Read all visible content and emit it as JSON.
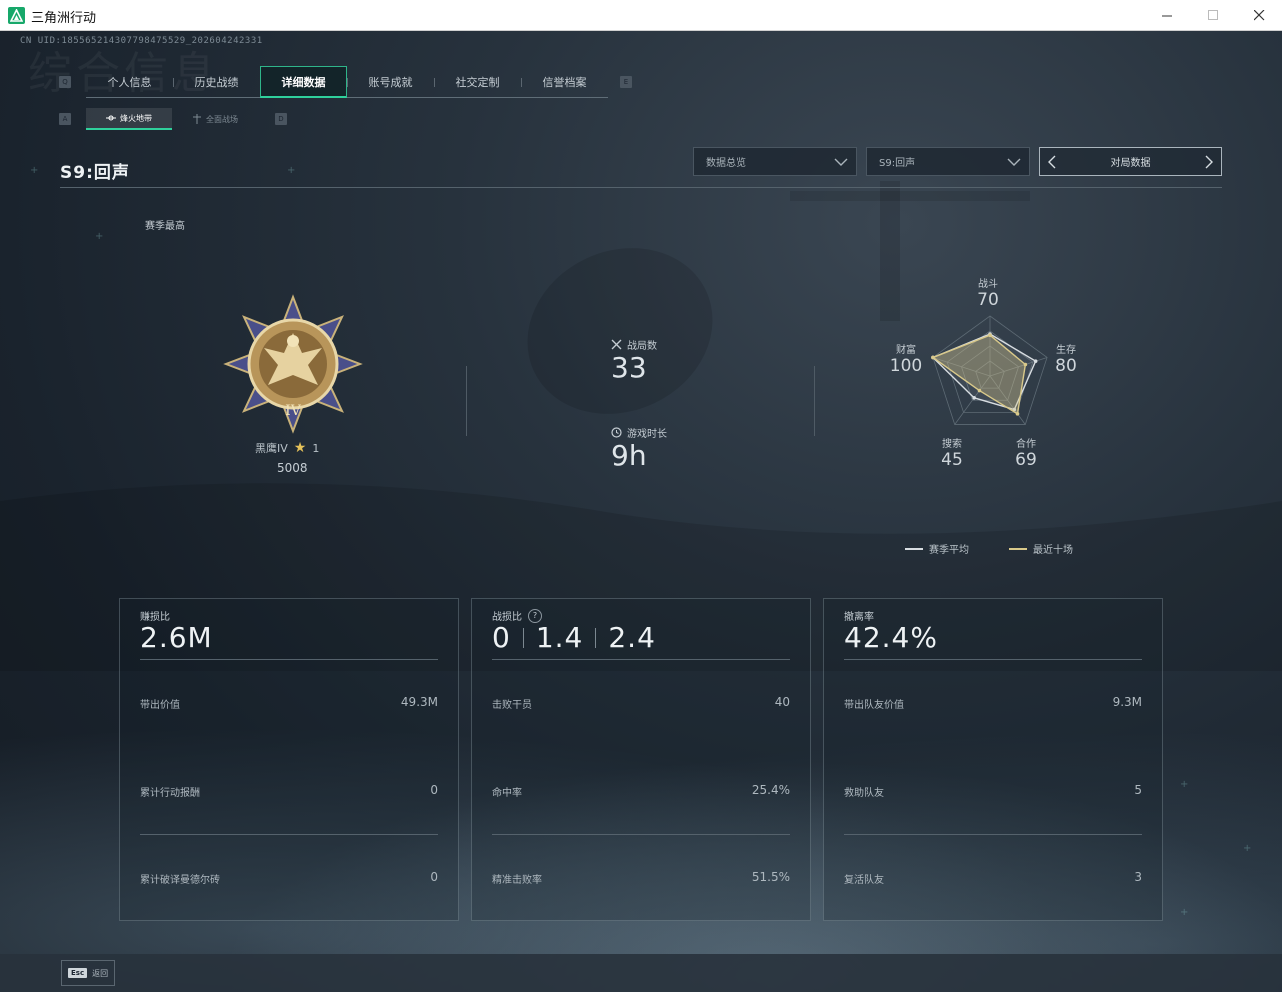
{
  "window": {
    "title": "三角洲行动"
  },
  "uid": "CN UID:18556521430779847552​9_202604242331",
  "watermark": "综合信息",
  "top_tabs": {
    "left_key": "Q",
    "right_key": "E",
    "items": [
      "个人信息",
      "历史战绩",
      "详细数据",
      "账号成就",
      "社交定制",
      "信誉档案"
    ],
    "active_index": 2
  },
  "sub_tabs": {
    "left_key": "A",
    "right_key": "D",
    "items": [
      "烽火地带",
      "全面战场"
    ],
    "active_index": 0
  },
  "season_title": "S9:回声",
  "filters": {
    "overview": "数据总览",
    "season": "S9:回声",
    "match_data": "对局数据"
  },
  "season_best_label": "赛季最高",
  "rank": {
    "name": "黑鹰IV",
    "stars": "1",
    "score": "5008",
    "medal_numeral": "IV"
  },
  "matches": {
    "label": "战局数",
    "value": "33"
  },
  "playtime": {
    "label": "游戏时长",
    "value": "9h"
  },
  "radar": {
    "axes": [
      {
        "label": "战斗",
        "value": "70"
      },
      {
        "label": "生存",
        "value": "80"
      },
      {
        "label": "合作",
        "value": "69"
      },
      {
        "label": "搜索",
        "value": "45"
      },
      {
        "label": "财富",
        "value": "100"
      }
    ],
    "season_avg": [
      0.7,
      0.8,
      0.69,
      0.45,
      1.0
    ],
    "recent_ten": [
      0.68,
      0.62,
      0.78,
      0.3,
      1.0
    ],
    "legend": {
      "season_avg": "赛季平均",
      "recent_ten": "最近十场"
    },
    "colors": {
      "season_avg": "#d8dde1",
      "recent_ten": "#d9c98a"
    }
  },
  "cards": [
    {
      "label": "赚损比",
      "value": "2.6M",
      "rows": [
        {
          "label": "带出价值",
          "value": "49.3M"
        },
        {
          "label": "累计行动报酬",
          "value": "0"
        },
        {
          "label": "累计破译曼德尔砖",
          "value": "0"
        }
      ]
    },
    {
      "label": "战损比",
      "help": "?",
      "ratio": [
        "0",
        "1.4",
        "2.4"
      ],
      "rows": [
        {
          "label": "击败干员",
          "value": "40"
        },
        {
          "label": "命中率",
          "value": "25.4%"
        },
        {
          "label": "精准击败率",
          "value": "51.5%"
        }
      ]
    },
    {
      "label": "撤离率",
      "value": "42.4%",
      "rows": [
        {
          "label": "带出队友价值",
          "value": "9.3M"
        },
        {
          "label": "救助队友",
          "value": "5"
        },
        {
          "label": "复活队友",
          "value": "3"
        }
      ]
    }
  ],
  "footer": {
    "esc_key": "Esc",
    "esc_label": "返回"
  }
}
